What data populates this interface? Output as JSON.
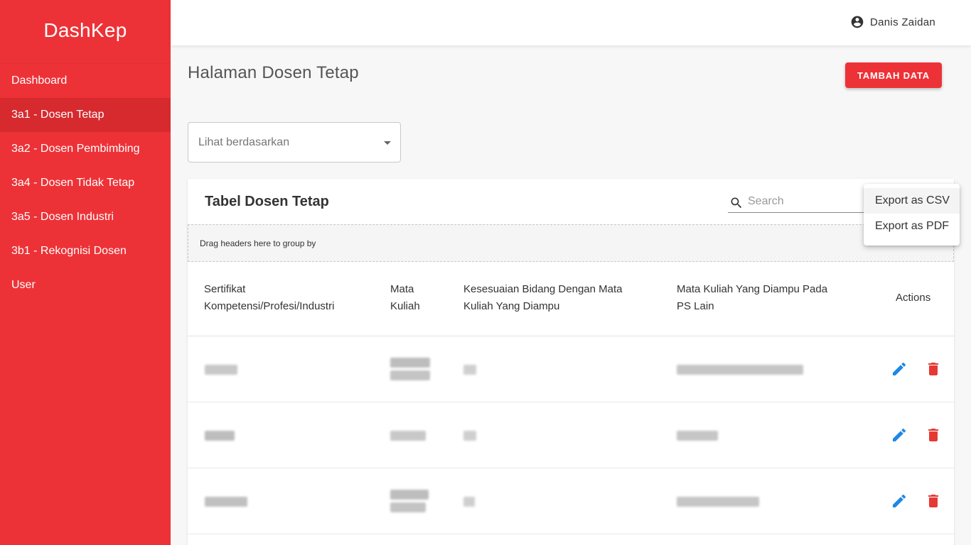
{
  "brand": "DashKep",
  "sidebar": {
    "items": [
      {
        "label": "Dashboard"
      },
      {
        "label": "3a1 - Dosen Tetap"
      },
      {
        "label": "3a2 - Dosen Pembimbing"
      },
      {
        "label": "3a4 - Dosen Tidak Tetap"
      },
      {
        "label": "3a5 - Dosen Industri"
      },
      {
        "label": "3b1 - Rekognisi Dosen"
      },
      {
        "label": "User"
      }
    ],
    "active_index": 1
  },
  "header": {
    "user_name": "Danis Zaidan",
    "user_icon": "account-circle-icon"
  },
  "page": {
    "title": "Halaman Dosen Tetap",
    "add_button": "TAMBAH DATA",
    "filter_placeholder": "Lihat berdasarkan"
  },
  "table": {
    "title": "Tabel Dosen Tetap",
    "search_placeholder": "Search",
    "group_hint": "Drag headers here to group by",
    "columns": {
      "col1_line1": "Sertifikat",
      "col1_line2": "Kompetensi/Profesi/Industri",
      "col2_line1": "Mata",
      "col2_line2": "Kuliah",
      "col3_line1": "Kesesuaian Bidang Dengan Mata",
      "col3_line2": "Kuliah Yang Diampu",
      "col4_line1": "Mata Kuliah Yang Diampu Pada",
      "col4_line2": "PS Lain",
      "actions": "Actions"
    },
    "rows_note": "cell contents are blurred/redacted in the screenshot",
    "row_count_visible": 3
  },
  "export_menu": {
    "items": [
      "Export as CSV",
      "Export as PDF"
    ]
  },
  "colors": {
    "primary": "#ed3237",
    "sidebar_active": "#d62a2f",
    "edit_icon": "#1e88e5",
    "delete_icon": "#e53935"
  }
}
